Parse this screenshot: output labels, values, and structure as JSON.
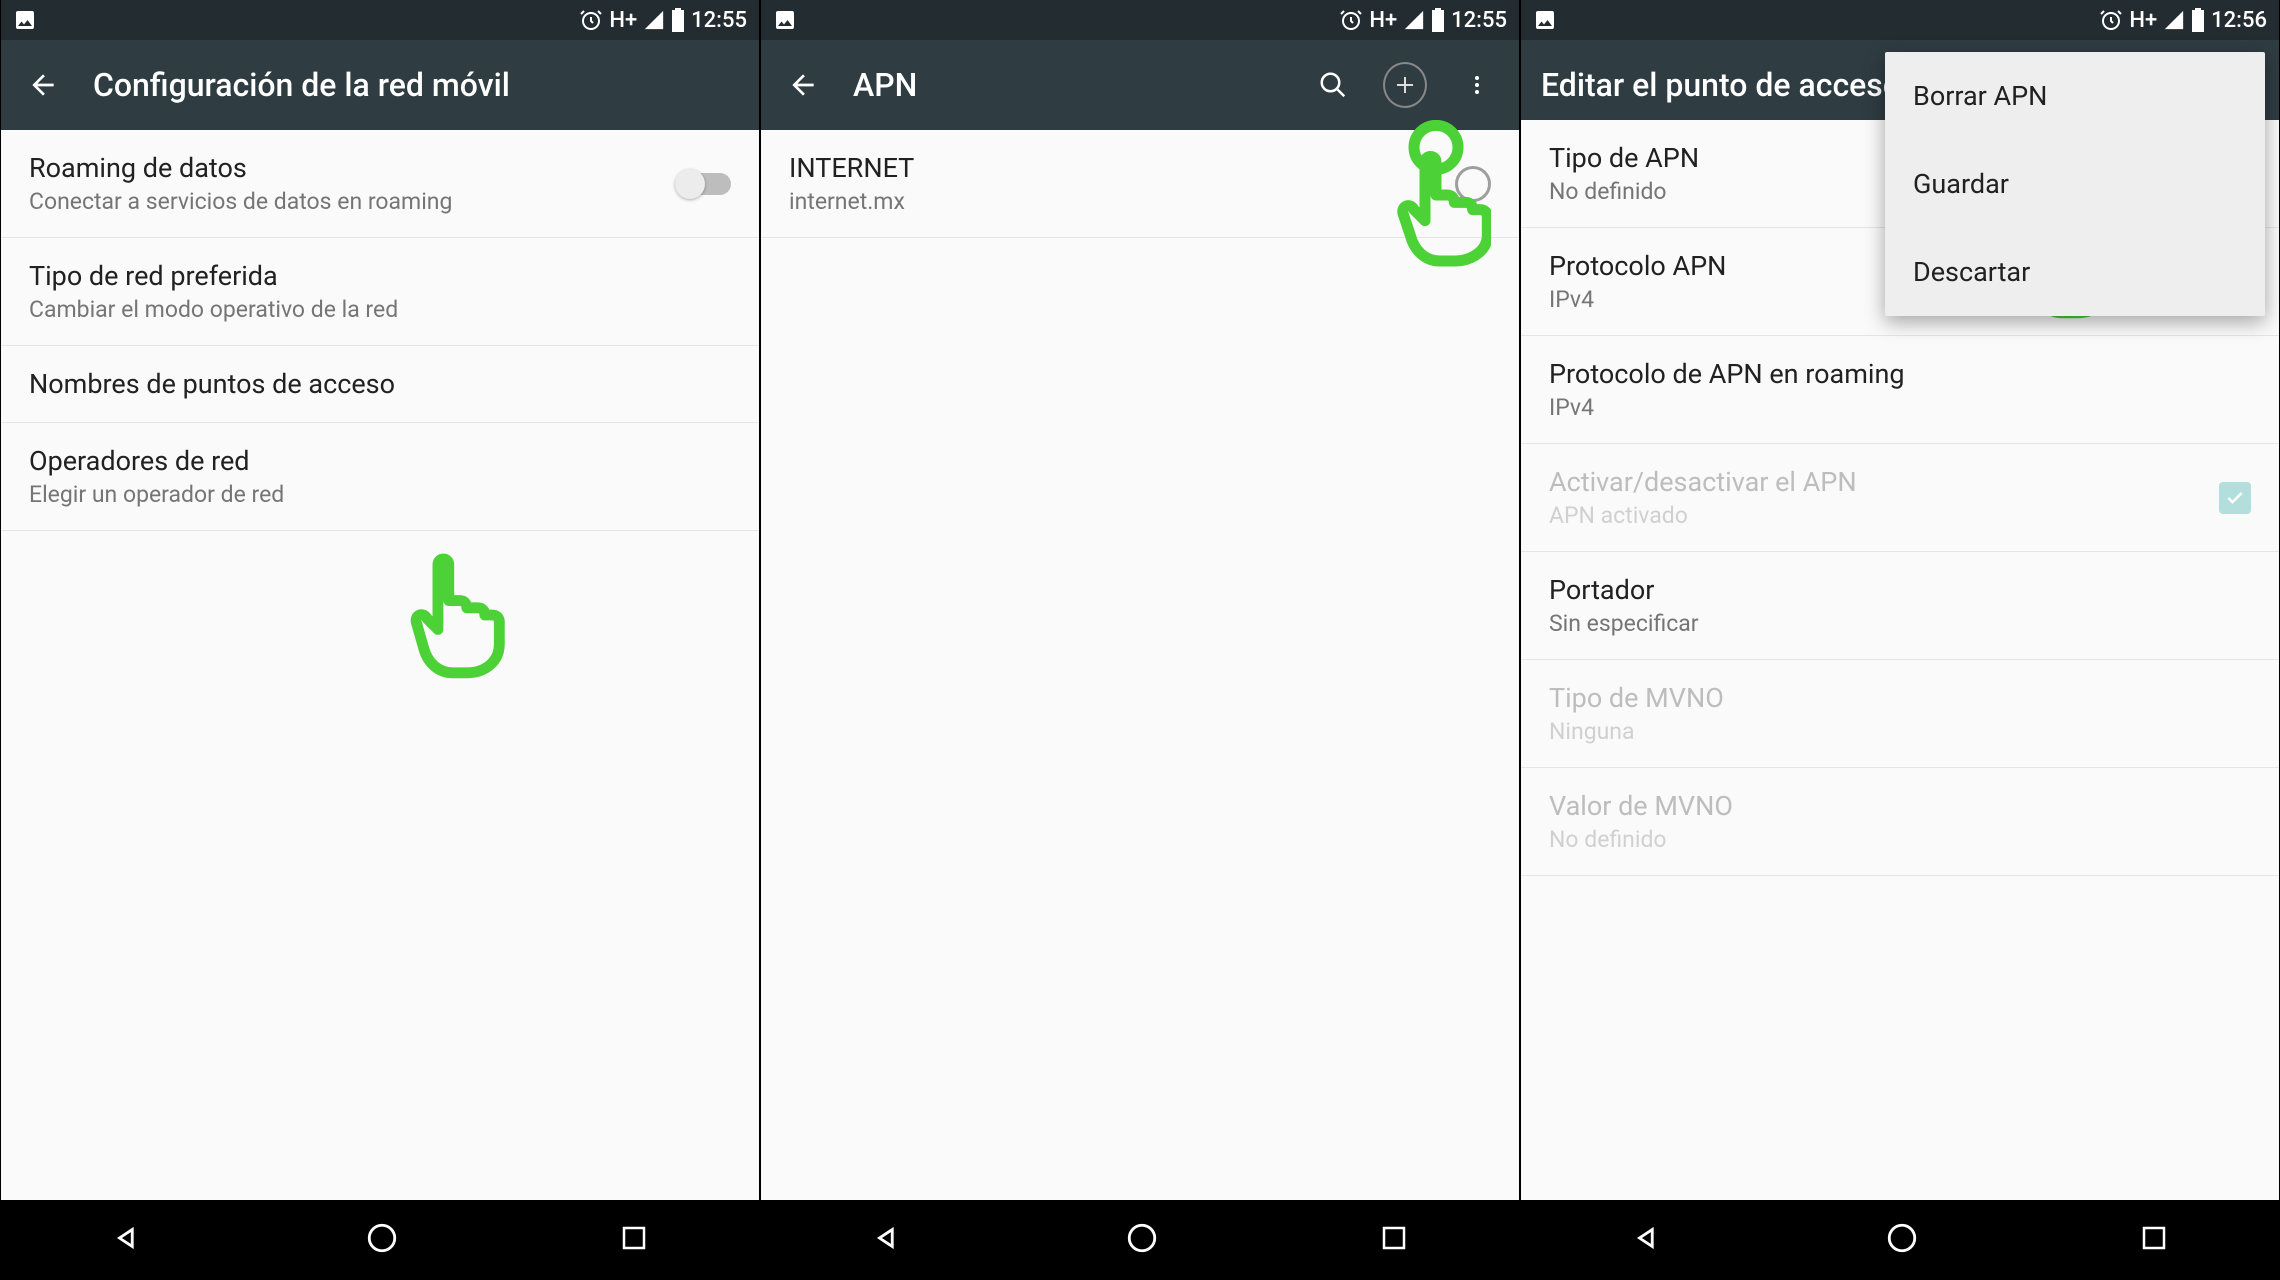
{
  "status": {
    "network": "H+",
    "time1": "12:55",
    "time2": "12:55",
    "time3": "12:56"
  },
  "screen1": {
    "title": "Configuración de la red móvil",
    "rows": [
      {
        "title": "Roaming de datos",
        "sub": "Conectar a servicios de datos en roaming"
      },
      {
        "title": "Tipo de red preferida",
        "sub": "Cambiar el modo operativo de la red"
      },
      {
        "title": "Nombres de puntos de acceso",
        "sub": ""
      },
      {
        "title": "Operadores de red",
        "sub": "Elegir un operador de red"
      }
    ]
  },
  "screen2": {
    "title": "APN",
    "apn": {
      "name": "INTERNET",
      "value": "internet.mx"
    }
  },
  "screen3": {
    "title": "Editar el punto de acceso",
    "rows": [
      {
        "title": "Tipo de APN",
        "sub": "No definido"
      },
      {
        "title": "Protocolo APN",
        "sub": "IPv4"
      },
      {
        "title": "Protocolo de APN en roaming",
        "sub": "IPv4"
      },
      {
        "title": "Activar/desactivar el APN",
        "sub": "APN activado"
      },
      {
        "title": "Portador",
        "sub": "Sin especificar"
      },
      {
        "title": "Tipo de MVNO",
        "sub": "Ninguna"
      },
      {
        "title": "Valor de MVNO",
        "sub": "No definido"
      }
    ],
    "menu": [
      "Borrar APN",
      "Guardar",
      "Descartar"
    ]
  }
}
